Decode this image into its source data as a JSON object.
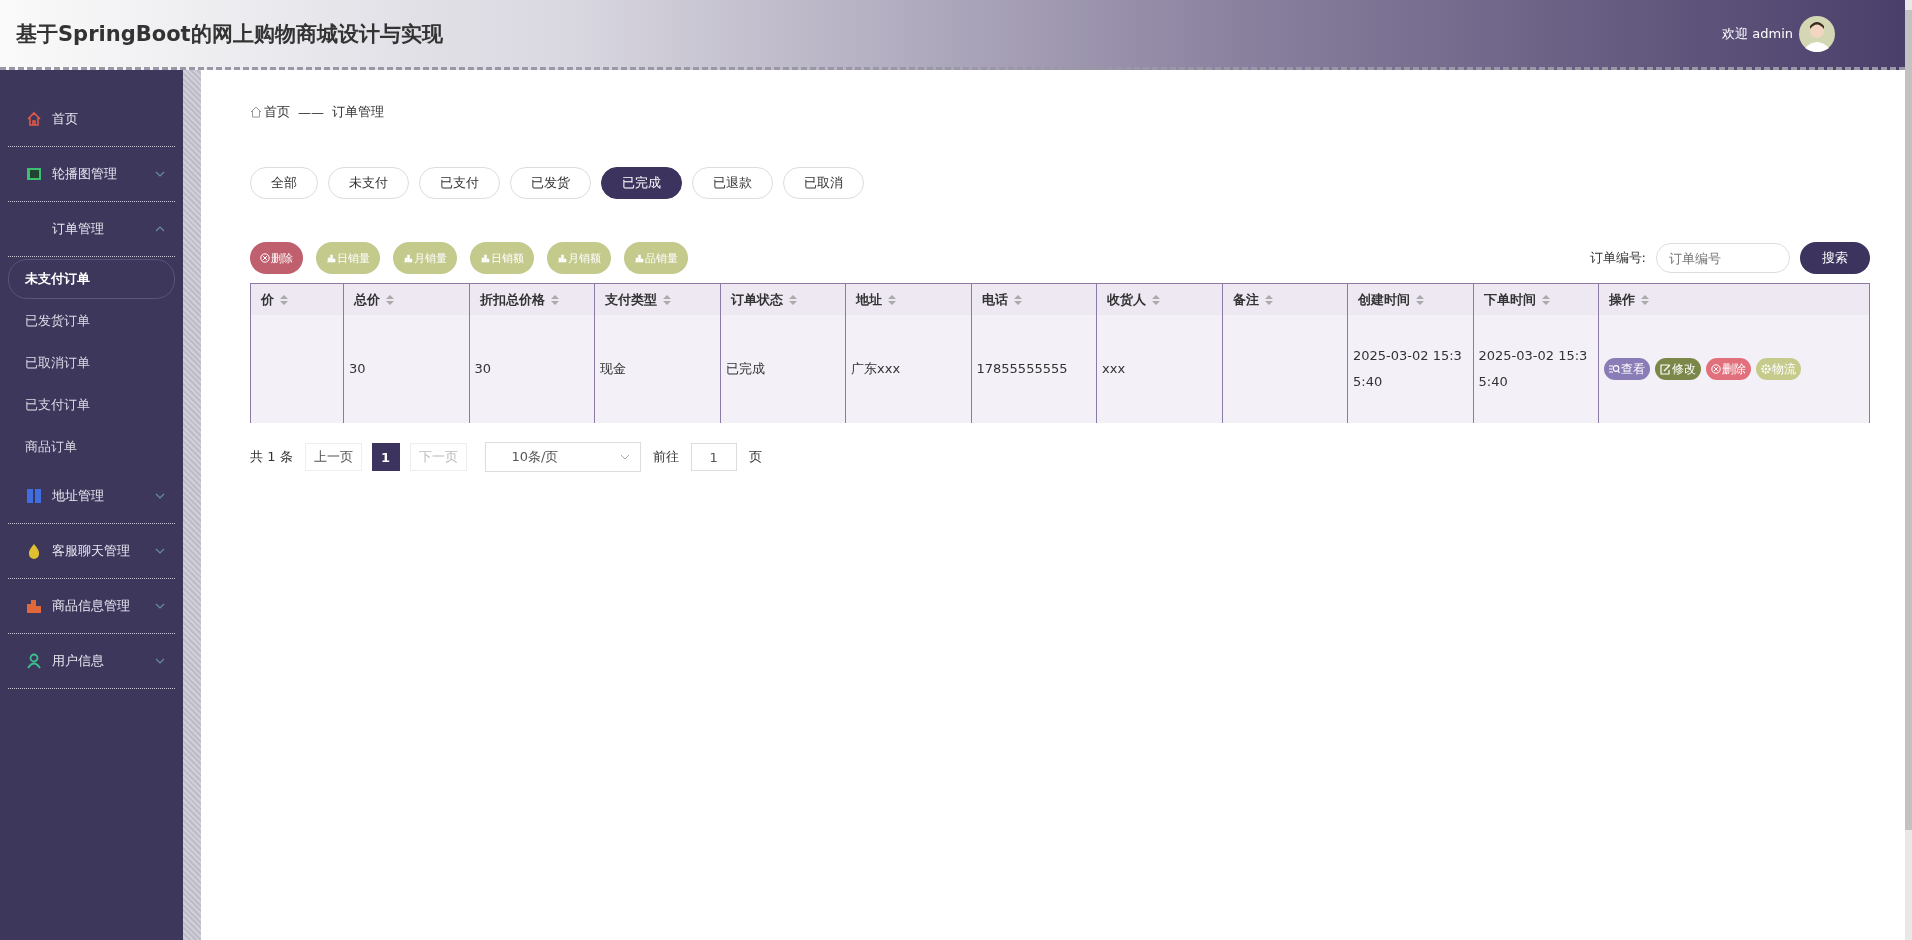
{
  "header": {
    "title": "基于SpringBoot的网上购物商城设计与实现",
    "welcome": "欢迎 admin"
  },
  "sidebar": {
    "items": [
      {
        "label": "首页",
        "kind": "home"
      },
      {
        "label": "轮播图管理",
        "kind": "banner",
        "expanded": false
      },
      {
        "label": "订单管理",
        "kind": "none",
        "expanded": true,
        "children": [
          {
            "label": "未支付订单",
            "selected": true
          },
          {
            "label": "已发货订单",
            "selected": false
          },
          {
            "label": "已取消订单",
            "selected": false
          },
          {
            "label": "已支付订单",
            "selected": false
          },
          {
            "label": "商品订单",
            "selected": false
          }
        ]
      },
      {
        "label": "地址管理",
        "kind": "address",
        "expanded": false
      },
      {
        "label": "客服聊天管理",
        "kind": "chat",
        "expanded": false
      },
      {
        "label": "商品信息管理",
        "kind": "goods",
        "expanded": false
      },
      {
        "label": "用户信息",
        "kind": "user",
        "expanded": false
      }
    ]
  },
  "breadcrumb": {
    "home": "首页",
    "separator": "——",
    "current": "订单管理"
  },
  "status_tabs": [
    {
      "label": "全部",
      "selected": false
    },
    {
      "label": "未支付",
      "selected": false
    },
    {
      "label": "已支付",
      "selected": false
    },
    {
      "label": "已发货",
      "selected": false
    },
    {
      "label": "已完成",
      "selected": true
    },
    {
      "label": "已退款",
      "selected": false
    },
    {
      "label": "已取消",
      "selected": false
    }
  ],
  "toolbar_buttons": [
    {
      "label": "删除",
      "kind": "delete"
    },
    {
      "label": "日销量",
      "kind": "stats"
    },
    {
      "label": "月销量",
      "kind": "stats"
    },
    {
      "label": "日销额",
      "kind": "stats"
    },
    {
      "label": "月销额",
      "kind": "stats"
    },
    {
      "label": "品销量",
      "kind": "stats"
    }
  ],
  "search": {
    "label": "订单编号:",
    "placeholder": "订单编号",
    "button": "搜索"
  },
  "table": {
    "columns": [
      "价",
      "总价",
      "折扣总价格",
      "支付类型",
      "订单状态",
      "地址",
      "电话",
      "收货人",
      "备注",
      "创建时间",
      "下单时间",
      "操作"
    ],
    "rows": [
      {
        "cells": [
          null,
          "30",
          "30",
          "现金",
          "已完成",
          "广东xxx",
          "17855555555",
          "xxx",
          null,
          "2025-03-02 15:35:40",
          "2025-03-02 15:35:40"
        ],
        "actions": [
          {
            "label": "查看",
            "kind": "view"
          },
          {
            "label": "修改",
            "kind": "edit"
          },
          {
            "label": "删除",
            "kind": "delete"
          },
          {
            "label": "物流",
            "kind": "logistics"
          }
        ]
      }
    ]
  },
  "pagination": {
    "total": "共 1 条",
    "prev": "上一页",
    "pages": [
      {
        "label": "1",
        "selected": true
      }
    ],
    "next": "下一页",
    "page_size": "10条/页",
    "goto_label": "前往",
    "goto_value": "1",
    "page_unit": "页"
  }
}
